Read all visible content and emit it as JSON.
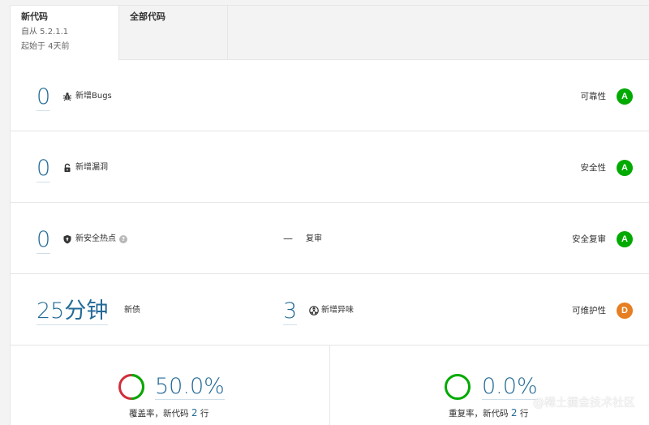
{
  "tabs": [
    {
      "title": "新代码",
      "since": "自从 5.2.1.1",
      "started": "起始于 4天前"
    },
    {
      "title": "全部代码"
    }
  ],
  "reliability": {
    "value": "0",
    "label": "新增Bugs",
    "rating_label": "可靠性",
    "rating": "A",
    "rating_color": "#00aa00"
  },
  "security": {
    "value": "0",
    "label": "新增漏洞",
    "rating_label": "安全性",
    "rating": "A",
    "rating_color": "#00aa00"
  },
  "hotspots": {
    "value": "0",
    "label": "新安全热点",
    "review_value": "—",
    "review_label": "复审",
    "rating_label": "安全复审",
    "rating": "A",
    "rating_color": "#00aa00"
  },
  "maintainability": {
    "debt_value": "25分钟",
    "debt_label": "新债",
    "smells_value": "3",
    "smells_label": "新增异味",
    "rating_label": "可维护性",
    "rating": "D",
    "rating_color": "#e67e22"
  },
  "coverage": {
    "value": "50.0%",
    "fraction": 0.5,
    "caption_prefix": "覆盖率，新代码",
    "lines": "2",
    "caption_suffix": "行"
  },
  "duplications": {
    "value": "0.0%",
    "caption_prefix": "重复率，新代码",
    "lines": "2",
    "caption_suffix": "行"
  },
  "watermark": "@稀土掘金技术社区",
  "colors": {
    "value_blue": "#236a97",
    "good": "#00aa00",
    "bad": "#d02f3a"
  }
}
